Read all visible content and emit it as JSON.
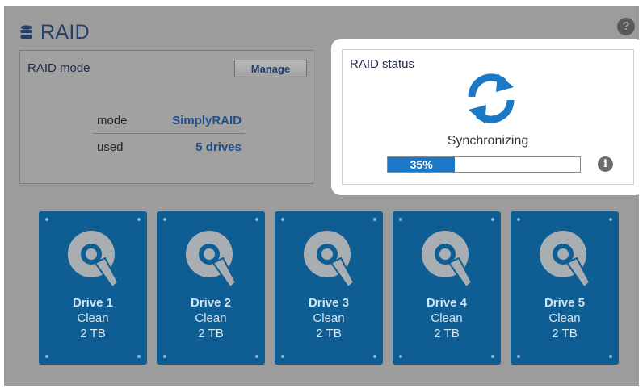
{
  "header": {
    "title": "RAID",
    "help_glyph": "?"
  },
  "mode_panel": {
    "heading": "RAID mode",
    "manage_label": "Manage",
    "rows": [
      {
        "key": "mode",
        "value": "SimplyRAID"
      },
      {
        "key": "used",
        "value": "5 drives"
      }
    ]
  },
  "status_panel": {
    "heading": "RAID status",
    "status_text": "Synchronizing",
    "progress_label": "35%",
    "progress_fraction": 0.35,
    "info_glyph": "i"
  },
  "drives": [
    {
      "name": "Drive 1",
      "state": "Clean",
      "capacity": "2 TB"
    },
    {
      "name": "Drive 2",
      "state": "Clean",
      "capacity": "2 TB"
    },
    {
      "name": "Drive 3",
      "state": "Clean",
      "capacity": "2 TB"
    },
    {
      "name": "Drive 4",
      "state": "Clean",
      "capacity": "2 TB"
    },
    {
      "name": "Drive 5",
      "state": "Clean",
      "capacity": "2 TB"
    }
  ],
  "icons": [
    "database-icon",
    "help-icon",
    "sync-icon",
    "info-icon",
    "hard-disk-icon"
  ],
  "colors": {
    "accent": "#1a78c6",
    "drive_tile": "#0f5e93",
    "title": "#233f6a"
  }
}
